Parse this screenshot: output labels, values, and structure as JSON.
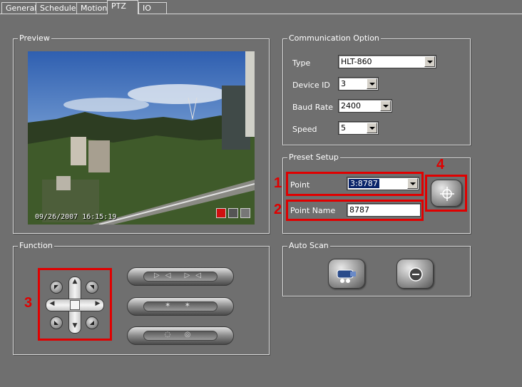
{
  "tabs": [
    {
      "label": "General"
    },
    {
      "label": "Schedule"
    },
    {
      "label": "Motion"
    },
    {
      "label": "PTZ",
      "active": true
    },
    {
      "label": "IO"
    }
  ],
  "preview": {
    "legend": "Preview",
    "timestamp": "09/26/2007  16:15:19",
    "overlay_icons": [
      "record-icon",
      "snapshot-icon",
      "chat-icon"
    ]
  },
  "communication": {
    "legend": "Communication Option",
    "type_label": "Type",
    "type_value": "HLT-860",
    "device_id_label": "Device ID",
    "device_id_value": "3",
    "baud_rate_label": "Baud Rate",
    "baud_rate_value": "2400",
    "speed_label": "Speed",
    "speed_value": "5"
  },
  "preset": {
    "legend": "Preset Setup",
    "point_label": "Point",
    "point_value": "3:8787",
    "point_name_label": "Point Name",
    "point_name_value": "8787",
    "goto_icon": "crosshair-icon"
  },
  "function": {
    "legend": "Function",
    "buttons": [
      "zoom-control",
      "focus-control",
      "iris-control"
    ]
  },
  "auto_scan": {
    "legend": "Auto Scan",
    "start_icon": "camera-scan-icon",
    "stop_icon": "stop-icon"
  },
  "callouts": [
    "1",
    "2",
    "3",
    "4"
  ],
  "colors": {
    "background": "#6f6f6f",
    "callout": "#e00000",
    "selection": "#0a246a"
  }
}
